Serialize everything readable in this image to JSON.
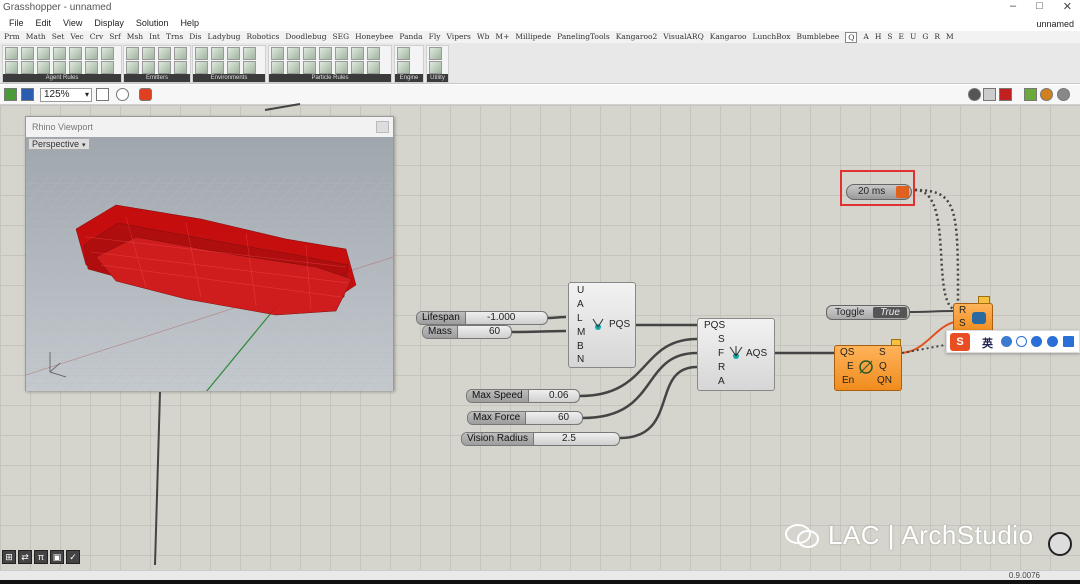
{
  "window": {
    "title": "Grasshopper - unnamed",
    "doc_name": "unnamed",
    "minimize": "–",
    "maximize": "□",
    "close": "✕"
  },
  "menu": [
    "File",
    "Edit",
    "View",
    "Display",
    "Solution",
    "Help"
  ],
  "tabs": [
    "Prm",
    "Math",
    "Set",
    "Vec",
    "Crv",
    "Srf",
    "Msh",
    "Int",
    "Trns",
    "Dis",
    "Ladybug",
    "Robotics",
    "Doodlebug",
    "SEG",
    "Honeybee",
    "Panda",
    "Fly",
    "Vipers",
    "Wb",
    "M+",
    "Millipede",
    "PanelingTools",
    "Kangaroo2",
    "VisualARQ",
    "Kangaroo",
    "LunchBox",
    "Bumblebee",
    "Q",
    "A",
    "H",
    "S",
    "E",
    "U",
    "G",
    "R",
    "M"
  ],
  "active_tab": "Q",
  "ribbon_groups": [
    "Agent Rules",
    "Emitters",
    "Environments",
    "Particle Rules",
    "Engine",
    "Utility",
    "Lab"
  ],
  "toolbar": {
    "zoom": "125%",
    "zoom_dd": "▾"
  },
  "viewport": {
    "title": "Rhino Viewport",
    "view": "Perspective",
    "view_dd": "▾"
  },
  "timer": {
    "label": "20 ms"
  },
  "inputs": {
    "lifespan": {
      "label": "Lifespan",
      "value": "-1.000"
    },
    "mass": {
      "label": "Mass",
      "value": "60"
    },
    "max_speed": {
      "label": "Max Speed",
      "value": "0.06"
    },
    "max_force": {
      "label": "Max Force",
      "value": "60"
    },
    "vision_radius": {
      "label": "Vision Radius",
      "value": "2.5"
    }
  },
  "pqs": {
    "name": "PQS",
    "ports": [
      "U",
      "A",
      "L",
      "M",
      "B",
      "N"
    ]
  },
  "aqs": {
    "name": "AQS",
    "in_ports": [
      "PQS",
      "S",
      "F",
      "R",
      "A"
    ]
  },
  "engine": {
    "in_ports": [
      "QS",
      "E",
      "En"
    ],
    "out_ports": [
      "S",
      "Q",
      "QN"
    ]
  },
  "output": {
    "ports": [
      "R",
      "S"
    ]
  },
  "toggle": {
    "label": "Toggle",
    "value": "True"
  },
  "ime": {
    "logo": "S",
    "text": "英"
  },
  "watermark": "LAC | ArchStudio",
  "bottom_tools": [
    "⊞",
    "⇄",
    "π",
    "▣",
    "✓"
  ],
  "status": {
    "version": "0.9.0076"
  },
  "colors": {
    "accent": "#e03030",
    "orange_component": "#f08c1e",
    "mesh_red": "#cc0000"
  }
}
